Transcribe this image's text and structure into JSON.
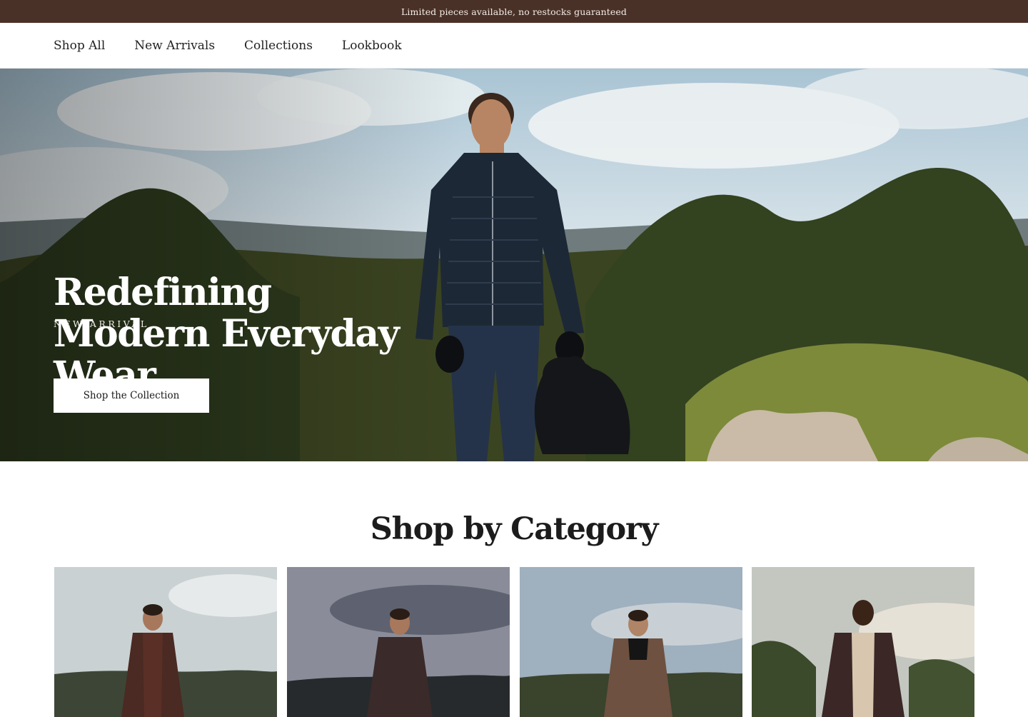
{
  "announcement": {
    "text": "Limited pieces available, no restocks guaranteed"
  },
  "nav": {
    "items": [
      {
        "label": "Shop All"
      },
      {
        "label": "New Arrivals"
      },
      {
        "label": "Collections"
      },
      {
        "label": "Lookbook"
      }
    ]
  },
  "hero": {
    "eyebrow": "NEW ARRIVAL",
    "title": "Redefining Modern Everyday Wear",
    "cta_label": "Shop the Collection"
  },
  "category_section": {
    "title": "Shop by Category",
    "cards": [
      {
        "jacket_color": "#4a2a22"
      },
      {
        "jacket_color": "#3b2a2a"
      },
      {
        "jacket_color": "#6e5140"
      },
      {
        "jacket_color": "#3a2726"
      }
    ]
  },
  "colors": {
    "announcement_bg": "#4a3127",
    "button_bg": "#ffffff"
  }
}
